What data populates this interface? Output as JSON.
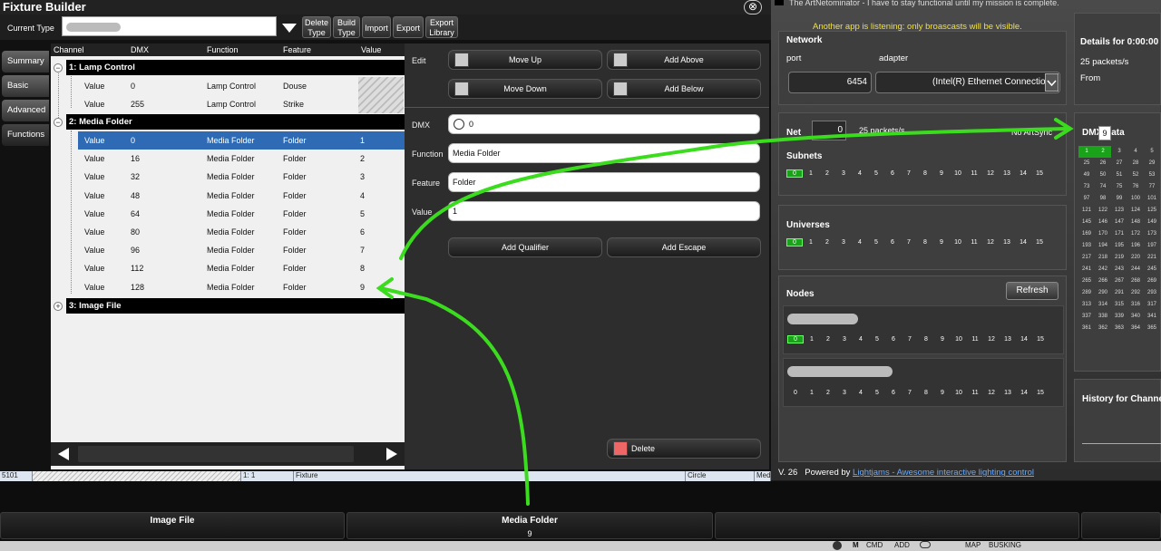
{
  "window": {
    "title": "Fixture Builder",
    "close": "⊗"
  },
  "toolbar": {
    "current_type_label": "Current Type",
    "buttons": [
      "Delete Type",
      "Build Type",
      "Import",
      "Export",
      "Export Library"
    ]
  },
  "side_tabs": [
    "Summary",
    "Basic",
    "Advanced",
    "Functions"
  ],
  "table": {
    "headers": [
      "Channel",
      "DMX",
      "Function",
      "Feature",
      "Value"
    ],
    "groups": [
      {
        "label": "1: Lamp Control",
        "rows": [
          {
            "c": "Value",
            "dmx": "0",
            "fn": "Lamp Control",
            "feat": "Douse",
            "val": ""
          },
          {
            "c": "Value",
            "dmx": "255",
            "fn": "Lamp Control",
            "feat": "Strike",
            "val": ""
          }
        ]
      },
      {
        "label": "2: Media Folder",
        "rows": [
          {
            "c": "Value",
            "dmx": "0",
            "fn": "Media Folder",
            "feat": "Folder",
            "val": "1"
          },
          {
            "c": "Value",
            "dmx": "16",
            "fn": "Media Folder",
            "feat": "Folder",
            "val": "2"
          },
          {
            "c": "Value",
            "dmx": "32",
            "fn": "Media Folder",
            "feat": "Folder",
            "val": "3"
          },
          {
            "c": "Value",
            "dmx": "48",
            "fn": "Media Folder",
            "feat": "Folder",
            "val": "4"
          },
          {
            "c": "Value",
            "dmx": "64",
            "fn": "Media Folder",
            "feat": "Folder",
            "val": "5"
          },
          {
            "c": "Value",
            "dmx": "80",
            "fn": "Media Folder",
            "feat": "Folder",
            "val": "6"
          },
          {
            "c": "Value",
            "dmx": "96",
            "fn": "Media Folder",
            "feat": "Folder",
            "val": "7"
          },
          {
            "c": "Value",
            "dmx": "112",
            "fn": "Media Folder",
            "feat": "Folder",
            "val": "8"
          },
          {
            "c": "Value",
            "dmx": "128",
            "fn": "Media Folder",
            "feat": "Folder",
            "val": "9"
          }
        ]
      },
      {
        "label": "3: Image File",
        "rows": []
      }
    ]
  },
  "edit": {
    "edit_label": "Edit",
    "move_up": "Move Up",
    "add_above": "Add Above",
    "move_down": "Move Down",
    "add_below": "Add Below",
    "dmx_label": "DMX",
    "dmx_value": "0",
    "function_label": "Function",
    "function_value": "Media Folder",
    "feature_label": "Feature",
    "feature_value": "Folder",
    "value_label": "Value",
    "value_value": "1",
    "add_qualifier": "Add Qualifier",
    "add_escape": "Add Escape",
    "delete": "Delete"
  },
  "status": {
    "s1": "5101",
    "s2": "1: 1",
    "s3": "Fixture",
    "s4": "Circle",
    "s5": "Med"
  },
  "artnet": {
    "title": "The ArtNetominator - I have to stay functional until my mission is complete.",
    "warning": "Another app is listening: only broascasts will be visible.",
    "network": "Network",
    "port_label": "port",
    "adapter_label": "adapter",
    "port": "6454",
    "adapter": "(Intel(R) Ethernet Connectio",
    "details": "Details for 0:00:00",
    "packets": "25 packets/s",
    "from": "From",
    "net": "Net",
    "net_value": "0",
    "packets2": "25 packets/s",
    "artsync": "No ArtSync",
    "dmx_data": "DMX Data",
    "dmx_tooltip": "9",
    "subnets": "Subnets",
    "universes": "Universes",
    "nodes": "Nodes",
    "refresh": "Refresh",
    "history": "History for Channel",
    "version": "V. 26",
    "powered_by": "Powered by",
    "powered_link": "Lightjams - Awesome interactive lighting control",
    "grid": [
      "0",
      "1",
      "2",
      "3",
      "4",
      "5",
      "6",
      "7",
      "8",
      "9",
      "10",
      "11",
      "12",
      "13",
      "14",
      "15"
    ],
    "dmx_grid": [
      [
        "1",
        "2",
        "3",
        "4",
        "5"
      ],
      [
        "25",
        "26",
        "27",
        "28",
        "29"
      ],
      [
        "49",
        "50",
        "51",
        "52",
        "53"
      ],
      [
        "73",
        "74",
        "75",
        "76",
        "77"
      ],
      [
        "97",
        "98",
        "99",
        "100",
        "101"
      ],
      [
        "121",
        "122",
        "123",
        "124",
        "125"
      ],
      [
        "145",
        "146",
        "147",
        "148",
        "149"
      ],
      [
        "169",
        "170",
        "171",
        "172",
        "173"
      ],
      [
        "193",
        "194",
        "195",
        "196",
        "197"
      ],
      [
        "217",
        "218",
        "219",
        "220",
        "221"
      ],
      [
        "241",
        "242",
        "243",
        "244",
        "245"
      ],
      [
        "265",
        "266",
        "267",
        "268",
        "269"
      ],
      [
        "289",
        "290",
        "291",
        "292",
        "293"
      ],
      [
        "313",
        "314",
        "315",
        "316",
        "317"
      ],
      [
        "337",
        "338",
        "339",
        "340",
        "341"
      ],
      [
        "361",
        "362",
        "363",
        "364",
        "365"
      ]
    ]
  },
  "bottom": {
    "b1": "Image File",
    "b2": "Media Folder",
    "b2_sub": "9"
  },
  "osbar": {
    "items": [
      "M",
      "CMD",
      "ADD",
      "MAP",
      "BUSKING"
    ]
  },
  "colors": {
    "accent_blue": "#2f6bb5",
    "green_arrow": "#3bdc1e",
    "warning_yellow": "#f0e040"
  }
}
